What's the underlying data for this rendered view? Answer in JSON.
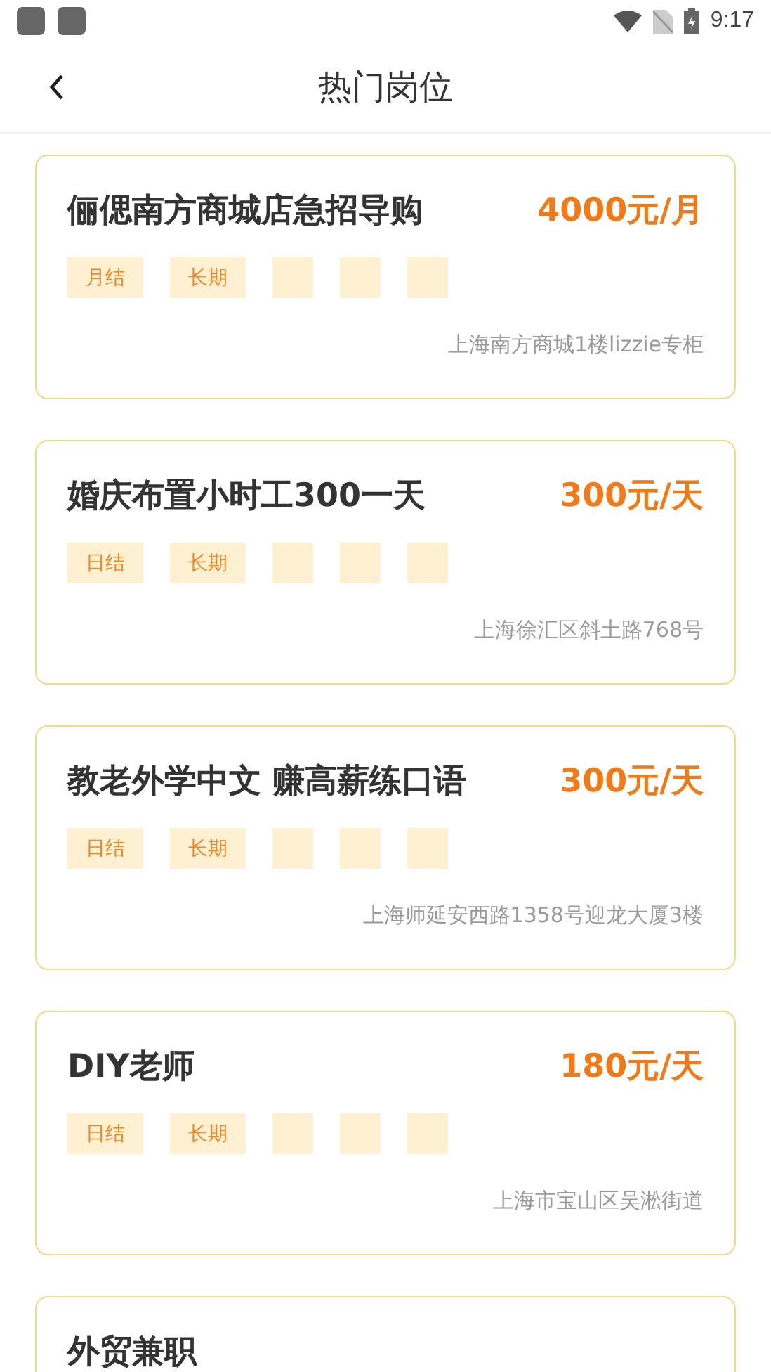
{
  "status_bar": {
    "time": "9:17"
  },
  "header": {
    "title": "热门岗位"
  },
  "jobs": [
    {
      "title": "俪偲南方商城店急招导购",
      "pay": "4000元/月",
      "tags": [
        {
          "kind": "label",
          "text": "月结"
        },
        {
          "kind": "label",
          "text": "长期"
        },
        {
          "kind": "blank"
        },
        {
          "kind": "blank"
        },
        {
          "kind": "blank"
        }
      ],
      "address": "上海南方商城1楼lizzie专柜"
    },
    {
      "title": "婚庆布置小时工300一天",
      "pay": "300元/天",
      "tags": [
        {
          "kind": "label",
          "text": "日结"
        },
        {
          "kind": "label",
          "text": "长期"
        },
        {
          "kind": "blank"
        },
        {
          "kind": "blank"
        },
        {
          "kind": "blank"
        }
      ],
      "address": "上海徐汇区斜土路768号"
    },
    {
      "title": "教老外学中文 赚高薪练口语",
      "pay": "300元/天",
      "tags": [
        {
          "kind": "label",
          "text": "日结"
        },
        {
          "kind": "label",
          "text": "长期"
        },
        {
          "kind": "blank"
        },
        {
          "kind": "blank"
        },
        {
          "kind": "blank"
        }
      ],
      "address": "上海师延安西路1358号迎龙大厦3楼"
    },
    {
      "title": "DIY老师",
      "pay": "180元/天",
      "tags": [
        {
          "kind": "label",
          "text": "日结"
        },
        {
          "kind": "label",
          "text": "长期"
        },
        {
          "kind": "blank"
        },
        {
          "kind": "blank"
        },
        {
          "kind": "blank"
        }
      ],
      "address": "上海市宝山区吴淞街道"
    },
    {
      "title": "外贸兼职"
    }
  ]
}
